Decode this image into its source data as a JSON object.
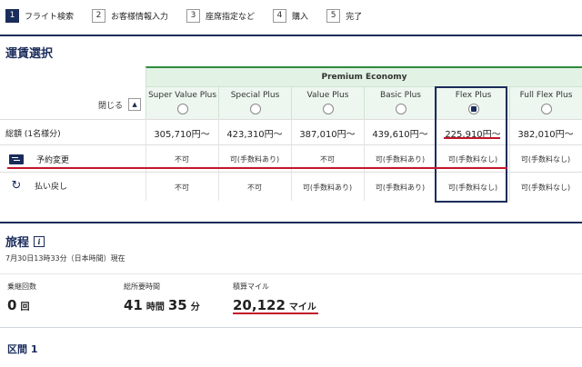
{
  "steps": [
    {
      "num": "1",
      "label": "フライト検索"
    },
    {
      "num": "2",
      "label": "お客様情報入力"
    },
    {
      "num": "3",
      "label": "座席指定など"
    },
    {
      "num": "4",
      "label": "購入"
    },
    {
      "num": "5",
      "label": "完了"
    }
  ],
  "fare_section": {
    "title": "運賃選択",
    "cabin": "Premium Economy",
    "close_label": "閉じる",
    "close_icon": "▲",
    "columns": [
      {
        "name": "Super Value Plus",
        "price": "305,710円～",
        "change": "不可",
        "refund": "不可",
        "selected": false
      },
      {
        "name": "Special Plus",
        "price": "423,310円～",
        "change": "可(手数料あり)",
        "refund": "不可",
        "selected": false
      },
      {
        "name": "Value Plus",
        "price": "387,010円～",
        "change": "不可",
        "refund": "可(手数料あり)",
        "selected": false
      },
      {
        "name": "Basic Plus",
        "price": "439,610円～",
        "change": "可(手数料あり)",
        "refund": "可(手数料あり)",
        "selected": false
      },
      {
        "name": "Flex Plus",
        "price": "225,910円～",
        "change": "可(手数料なし)",
        "refund": "可(手数料なし)",
        "selected": true
      },
      {
        "name": "Full Flex Plus",
        "price": "382,010円～",
        "change": "可(手数料なし)",
        "refund": "可(手数料なし)",
        "selected": false
      }
    ],
    "rows": {
      "total_label": "総額 (1名様分)",
      "change_label": "予約変更",
      "refund_label": "払い戻し"
    }
  },
  "itinerary": {
    "title": "旅程",
    "info_icon": "i",
    "timestamp": "7月30日13時33分（日本時間）現在",
    "stats": {
      "flights_label": "乗継回数",
      "flights_value": "0",
      "flights_unit": "回",
      "duration_label": "総所要時間",
      "duration_hours": "41",
      "duration_hours_unit": "時間",
      "duration_minutes": "35",
      "duration_minutes_unit": "分",
      "miles_label": "積算マイル",
      "miles_value": "20,122",
      "miles_unit": "マイル"
    }
  },
  "segment": {
    "title": "区間 1"
  },
  "colors": {
    "navy": "#1a2c5b",
    "green": "#2e8b3c",
    "red": "#c3162a"
  }
}
